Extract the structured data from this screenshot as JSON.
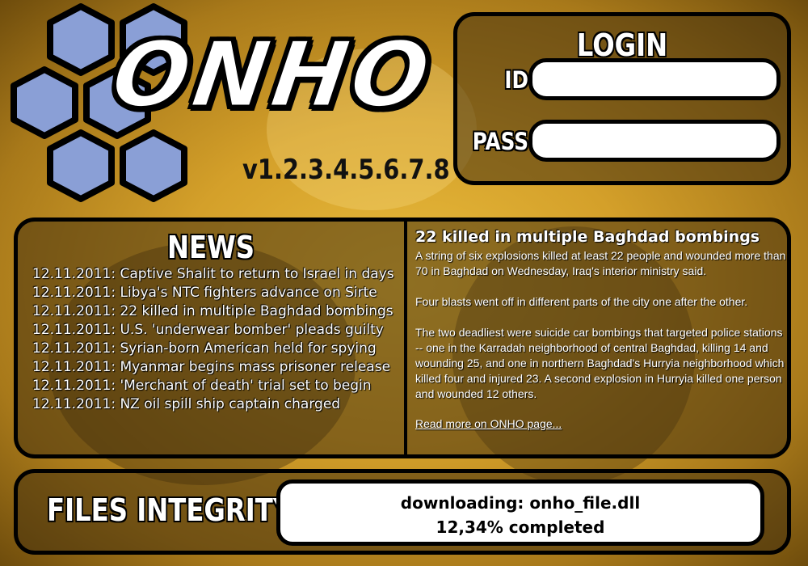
{
  "logo": {
    "text": "ONHO",
    "version": "v1.2.3.4.5.6.7.8"
  },
  "login": {
    "title": "LOGIN",
    "id_label": "ID",
    "pass_label": "PASS",
    "id_value": "",
    "pass_value": ""
  },
  "news": {
    "title": "NEWS",
    "items": [
      "12.11.2011: Captive Shalit to return to Israel in days",
      "12.11.2011: Libya's NTC fighters advance on Sirte",
      "12.11.2011: 22 killed in multiple Baghdad bombings",
      "12.11.2011: U.S. 'underwear bomber' pleads guilty",
      "12.11.2011: Syrian-born American held for spying",
      "12.11.2011: Myanmar begins mass prisoner release",
      "12.11.2011: 'Merchant of death' trial set to begin",
      "12.11.2011: NZ oil spill ship captain charged"
    ]
  },
  "article": {
    "title": "22 killed in multiple Baghdad bombings",
    "paragraphs": [
      "A string of six explosions killed at least 22 people and wounded more than 70 in Baghdad on Wednesday, Iraq's interior ministry said.",
      "Four blasts went off in different parts of the city one after the other.",
      "The two deadliest were suicide car bombings that targeted police stations -- one in the Karradah neighborhood of central Baghdad, killing 14 and wounding 25, and one in northern Baghdad's Hurryia neighborhood which killed four and injured 23. A second explosion in Hurryia killed one person and wounded 12 others."
    ],
    "read_more": "Read more on ONHO page..."
  },
  "files": {
    "title": "FILES INTEGRITY",
    "status_line1": "downloading: onho_file.dll",
    "status_line2": "12,34% completed",
    "progress_percent": 12.34
  },
  "colors": {
    "hexagon": "#8a9fd6",
    "background": "#d4a02a",
    "panel_border": "#000000"
  }
}
